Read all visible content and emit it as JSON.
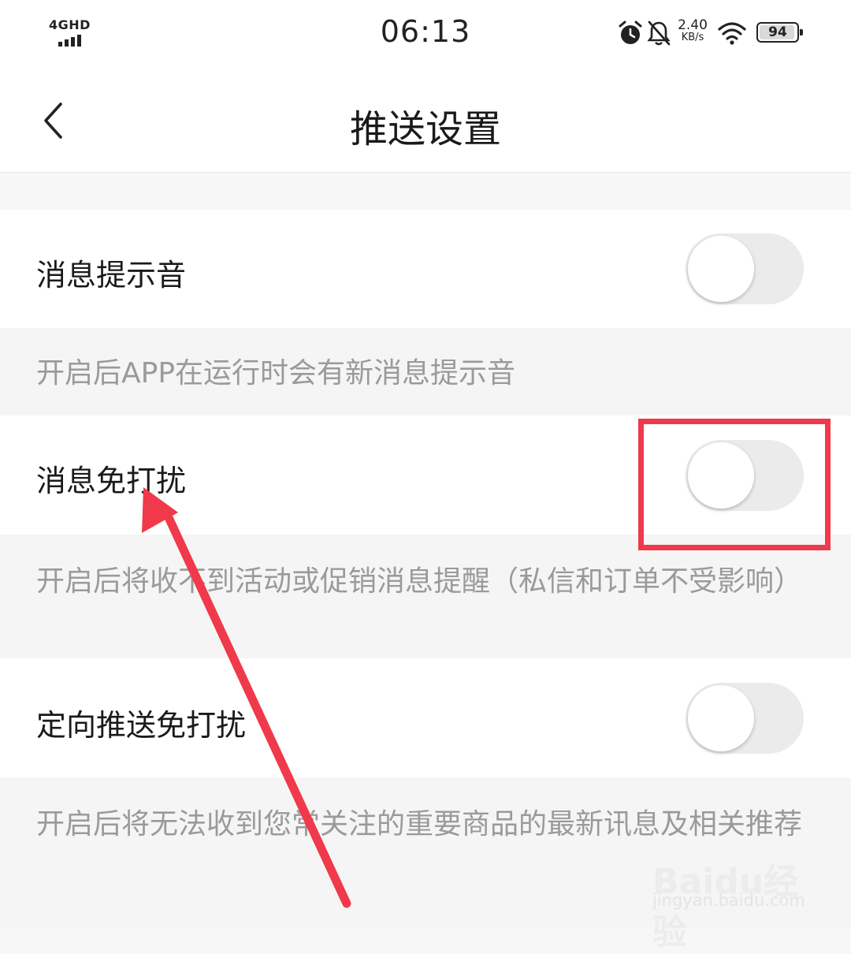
{
  "status_bar": {
    "network": "4GHD",
    "time": "06:13",
    "net_speed_value": "2.40",
    "net_speed_unit": "KB/s",
    "battery": "94",
    "icons": [
      "alarm-icon",
      "bell-off-icon",
      "wifi-icon",
      "battery-icon"
    ]
  },
  "header": {
    "title": "推送设置",
    "back_icon": "chevron-left-icon"
  },
  "settings": [
    {
      "label": "消息提示音",
      "enabled": false,
      "description": "开启后APP在运行时会有新消息提示音"
    },
    {
      "label": "消息免打扰",
      "enabled": false,
      "description": "开启后将收不到活动或促销消息提醒（私信和订单不受影响）"
    },
    {
      "label": "定向推送免打扰",
      "enabled": false,
      "description": "开启后将无法收到您常关注的重要商品的最新讯息及相关推荐"
    }
  ],
  "watermark": {
    "brand": "Baidu经验",
    "url": "jingyan.baidu.com"
  },
  "colors": {
    "annotation": "#f0394a",
    "toggle_off": "#ebebeb",
    "description_text": "#9a9a9a"
  }
}
